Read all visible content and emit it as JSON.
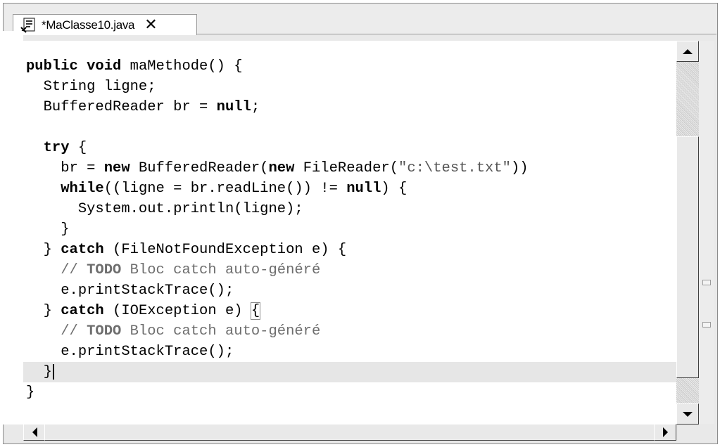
{
  "tab": {
    "title": "*MaClasse10.java",
    "close": "✕",
    "icon": "java-file-icon"
  },
  "code": [
    {
      "indent": "",
      "parts": [
        [
          "kw",
          "public"
        ],
        [
          "t",
          " "
        ],
        [
          "kw",
          "void"
        ],
        [
          "t",
          " maMethode() {"
        ]
      ]
    },
    {
      "indent": "  ",
      "parts": [
        [
          "t",
          "String ligne;"
        ]
      ]
    },
    {
      "indent": "  ",
      "parts": [
        [
          "t",
          "BufferedReader br = "
        ],
        [
          "kw",
          "null"
        ],
        [
          "t",
          ";"
        ]
      ]
    },
    {
      "indent": "",
      "parts": []
    },
    {
      "indent": "  ",
      "parts": [
        [
          "kw",
          "try"
        ],
        [
          "t",
          " {"
        ]
      ]
    },
    {
      "indent": "    ",
      "parts": [
        [
          "t",
          "br = "
        ],
        [
          "kw",
          "new"
        ],
        [
          "t",
          " BufferedReader("
        ],
        [
          "kw",
          "new"
        ],
        [
          "t",
          " FileReader("
        ],
        [
          "str",
          "\"c:\\test.txt\""
        ],
        [
          "t",
          "))"
        ]
      ]
    },
    {
      "indent": "    ",
      "parts": [
        [
          "kw",
          "while"
        ],
        [
          "t",
          "((ligne = br.readLine()) != "
        ],
        [
          "kw",
          "null"
        ],
        [
          "t",
          ") {"
        ]
      ]
    },
    {
      "indent": "      ",
      "parts": [
        [
          "t",
          "System.out.println(ligne);"
        ]
      ]
    },
    {
      "indent": "    ",
      "parts": [
        [
          "t",
          "}"
        ]
      ]
    },
    {
      "indent": "  ",
      "parts": [
        [
          "t",
          "} "
        ],
        [
          "kw",
          "catch"
        ],
        [
          "t",
          " (FileNotFoundException e) {"
        ]
      ]
    },
    {
      "indent": "    ",
      "parts": [
        [
          "cmt",
          "// "
        ],
        [
          "todo",
          "TODO"
        ],
        [
          "cmt",
          " Bloc catch auto-généré"
        ]
      ]
    },
    {
      "indent": "    ",
      "parts": [
        [
          "t",
          "e.printStackTrace();"
        ]
      ]
    },
    {
      "indent": "  ",
      "parts": [
        [
          "t",
          "} "
        ],
        [
          "kw",
          "catch"
        ],
        [
          "t",
          " (IOException e) "
        ],
        [
          "box",
          "{"
        ]
      ]
    },
    {
      "indent": "    ",
      "parts": [
        [
          "cmt",
          "// "
        ],
        [
          "todo",
          "TODO"
        ],
        [
          "cmt",
          " Bloc catch auto-généré"
        ]
      ]
    },
    {
      "indent": "    ",
      "parts": [
        [
          "t",
          "e.printStackTrace();"
        ]
      ]
    },
    {
      "indent": "  ",
      "parts": [
        [
          "t",
          "}"
        ],
        [
          "caret",
          ""
        ]
      ],
      "current": true
    },
    {
      "indent": "",
      "parts": [
        [
          "t",
          "}"
        ]
      ]
    }
  ],
  "colors": {
    "keyword": "#000000",
    "comment": "#6e6e6e",
    "current_line": "#e6e6e6"
  }
}
